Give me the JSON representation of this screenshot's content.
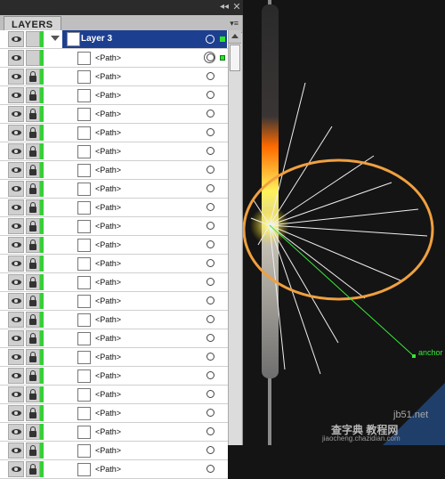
{
  "panel": {
    "tab_label": "LAYERS",
    "collapse_glyph": "◂◂",
    "close_glyph": "✕",
    "menu_glyph": "▾≡"
  },
  "layer": {
    "name": "Layer 3",
    "color": "#1c3f90"
  },
  "path_label": "<Path>",
  "path_rows": [
    {
      "label": "<Path>",
      "locked": false,
      "targeted": true
    },
    {
      "label": "<Path>",
      "locked": true
    },
    {
      "label": "<Path>",
      "locked": true
    },
    {
      "label": "<Path>",
      "locked": true
    },
    {
      "label": "<Path>",
      "locked": true
    },
    {
      "label": "<Path>",
      "locked": true
    },
    {
      "label": "<Path>",
      "locked": true
    },
    {
      "label": "<Path>",
      "locked": true
    },
    {
      "label": "<Path>",
      "locked": true
    },
    {
      "label": "<Path>",
      "locked": true
    },
    {
      "label": "<Path>",
      "locked": true
    },
    {
      "label": "<Path>",
      "locked": true
    },
    {
      "label": "<Path>",
      "locked": true
    },
    {
      "label": "<Path>",
      "locked": true
    },
    {
      "label": "<Path>",
      "locked": true
    },
    {
      "label": "<Path>",
      "locked": true
    },
    {
      "label": "<Path>",
      "locked": true
    },
    {
      "label": "<Path>",
      "locked": true
    },
    {
      "label": "<Path>",
      "locked": true
    },
    {
      "label": "<Path>",
      "locked": true
    },
    {
      "label": "<Path>",
      "locked": true
    },
    {
      "label": "<Path>",
      "locked": true
    },
    {
      "label": "<Path>",
      "locked": true
    }
  ],
  "artwork": {
    "anchor_label": "anchor",
    "ellipse_color": "#f0a040",
    "selection_color": "#38e838"
  },
  "watermark": {
    "line1": "jb51.net",
    "line2": "查字典 教程网",
    "line3": "jiaocheng.chazidian.com"
  }
}
